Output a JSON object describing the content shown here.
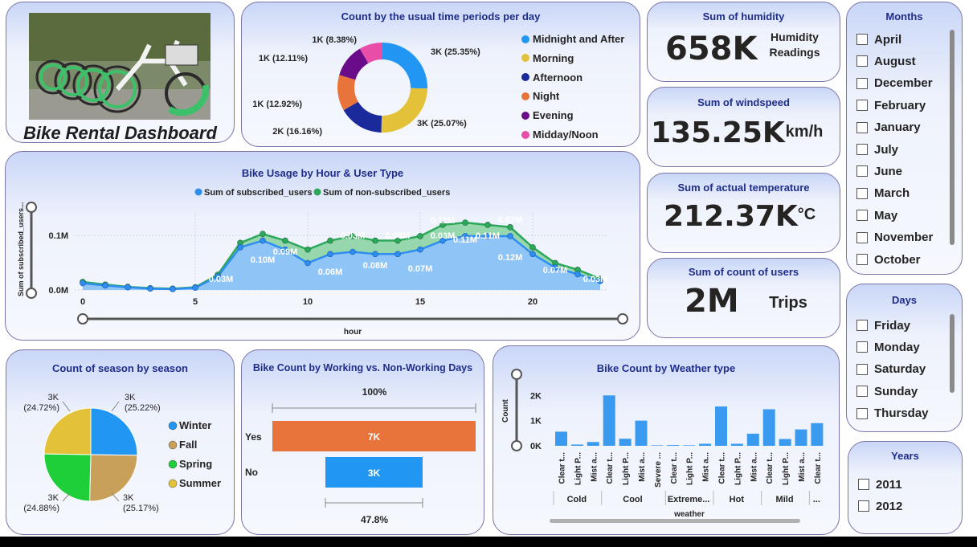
{
  "header": {
    "title": "Bike Rental Dashboard"
  },
  "time_periods": {
    "title": "Count by the usual time periods per day",
    "legend": [
      "Midnight and After",
      "Morning",
      "Afternoon",
      "Night",
      "Evening",
      "Midday/Noon"
    ],
    "colors": [
      "#2196f3",
      "#e3c23a",
      "#1a2a9a",
      "#e8743b",
      "#6a0c8a",
      "#e84ea8"
    ],
    "labels": [
      "3K (25.35%)",
      "3K (25.07%)",
      "2K (16.16%)",
      "1K (12.92%)",
      "1K (12.11%)",
      "1K (8.38%)"
    ]
  },
  "kpis": {
    "humidity": {
      "title": "Sum of humidity",
      "value": "658K",
      "unit": "Humidity Readings"
    },
    "windspeed": {
      "title": "Sum of windspeed",
      "value": "135.25K",
      "unit": "km/h"
    },
    "temperature": {
      "title": "Sum of actual temperature",
      "value": "212.37K",
      "unit": "°C"
    },
    "users": {
      "title": "Sum of count of users",
      "value": "2M",
      "unit": "Trips"
    }
  },
  "months_slicer": {
    "title": "Months",
    "items": [
      "April",
      "August",
      "December",
      "February",
      "January",
      "July",
      "June",
      "March",
      "May",
      "November",
      "October"
    ]
  },
  "days_slicer": {
    "title": "Days",
    "items": [
      "Friday",
      "Monday",
      "Saturday",
      "Sunday",
      "Thursday"
    ]
  },
  "years_slicer": {
    "title": "Years",
    "items": [
      "2011",
      "2012"
    ]
  },
  "hourly": {
    "title": "Bike Usage by Hour & User Type",
    "legend": [
      "Sum of subscribed_users",
      "Sum of non-subscribed_users"
    ],
    "colors": [
      "#2d8ef0",
      "#2da85a"
    ],
    "ylabel": "Sum of subscribed_users...",
    "xlabel": "hour",
    "yticks": [
      "0.1M",
      "0.0M"
    ],
    "xticks": [
      "0",
      "5",
      "10",
      "15",
      "20"
    ],
    "point_labels": [
      "0.03M",
      "0.10M",
      "0.09M",
      "0.06M",
      "0.03M",
      "0.08M",
      "0.03M",
      "0.07M",
      "0.03M",
      "0.11M",
      "0.11M",
      "0.11M",
      "0.02M",
      "0.12M",
      "0.07M",
      "0.03M"
    ]
  },
  "season": {
    "title": "Count of season by season",
    "legend": [
      "Winter",
      "Fall",
      "Spring",
      "Summer"
    ],
    "colors": [
      "#2196f3",
      "#c8a05a",
      "#1fcf3a",
      "#e3c23a"
    ],
    "labels": [
      "3K (25.22%)",
      "3K (25.17%)",
      "3K (24.88%)",
      "3K (24.72%)"
    ]
  },
  "working": {
    "title": "Bike Count by Working vs. Non-Working Days",
    "top_label": "100%",
    "bottom_label": "47.8%",
    "rows": [
      {
        "label": "Yes",
        "value": "7K",
        "color": "#e8743b"
      },
      {
        "label": "No",
        "value": "3K",
        "color": "#2196f3"
      }
    ]
  },
  "weather": {
    "title": "Bike Count by Weather type",
    "ylabel": "Count",
    "xlabel": "weather",
    "yticks": [
      "2K",
      "1K",
      "0K"
    ],
    "bar_labels": [
      "Clear t...",
      "Light P...",
      "Mist a...",
      "Clear t...",
      "Light P...",
      "Mist a...",
      "Severe ...",
      "Clear t...",
      "Light P...",
      "Mist a...",
      "Clear t...",
      "Light P...",
      "Mist a...",
      "Clear t...",
      "Light P...",
      "Mist a...",
      "Clear t..."
    ],
    "groups": [
      "Cold",
      "Cool",
      "Extreme...",
      "Hot",
      "Mild",
      "..."
    ]
  },
  "chart_data": [
    {
      "type": "pie",
      "title": "Count by the usual time periods per day",
      "categories": [
        "Midnight and After",
        "Morning",
        "Afternoon",
        "Night",
        "Evening",
        "Midday/Noon"
      ],
      "values": [
        25.35,
        25.07,
        16.16,
        12.92,
        12.11,
        8.38
      ]
    },
    {
      "type": "area",
      "title": "Bike Usage by Hour & User Type",
      "xlabel": "hour",
      "x": [
        0,
        1,
        2,
        3,
        4,
        5,
        6,
        7,
        8,
        9,
        10,
        11,
        12,
        13,
        14,
        15,
        16,
        17,
        18,
        19,
        20,
        21,
        22,
        23
      ],
      "series": [
        {
          "name": "Sum of subscribed_users",
          "values": [
            0.015,
            0.01,
            0.006,
            0.003,
            0.002,
            0.005,
            0.03,
            0.095,
            0.11,
            0.09,
            0.06,
            0.08,
            0.085,
            0.08,
            0.08,
            0.09,
            0.11,
            0.12,
            0.12,
            0.12,
            0.08,
            0.05,
            0.035,
            0.02
          ]
        },
        {
          "name": "Sum of non-subscribed_users",
          "values": [
            0.003,
            0.002,
            0.001,
            0.001,
            0.001,
            0.001,
            0.004,
            0.01,
            0.015,
            0.02,
            0.03,
            0.03,
            0.035,
            0.03,
            0.03,
            0.03,
            0.035,
            0.03,
            0.025,
            0.02,
            0.015,
            0.01,
            0.01,
            0.005
          ]
        }
      ]
    },
    {
      "type": "pie",
      "title": "Count of season by season",
      "categories": [
        "Winter",
        "Fall",
        "Spring",
        "Summer"
      ],
      "values": [
        25.22,
        25.17,
        24.88,
        24.72
      ]
    },
    {
      "type": "bar",
      "title": "Bike Count by Working vs. Non-Working Days",
      "categories": [
        "Yes",
        "No"
      ],
      "values": [
        7,
        3
      ]
    },
    {
      "type": "bar",
      "title": "Bike Count by Weather type",
      "ylabel": "Count",
      "xlabel": "weather",
      "categories": [
        "Cold - Clear t...",
        "Cold - Light P...",
        "Cold - Mist a...",
        "Cool - Clear t...",
        "Cool - Light P...",
        "Cool - Mist a...",
        "Cool - Severe ...",
        "Extreme - Clear t...",
        "Extreme - Light P...",
        "Extreme - Mist a...",
        "Hot - Clear t...",
        "Hot - Light P...",
        "Hot - Mist a...",
        "Mild - Clear t...",
        "Mild - Light P...",
        "Mild - Mist a...",
        "... - Clear t..."
      ],
      "values": [
        560,
        50,
        150,
        2000,
        280,
        1000,
        20,
        30,
        20,
        80,
        1560,
        80,
        480,
        1450,
        270,
        650,
        900
      ],
      "ylim": [
        0,
        2200
      ]
    }
  ]
}
